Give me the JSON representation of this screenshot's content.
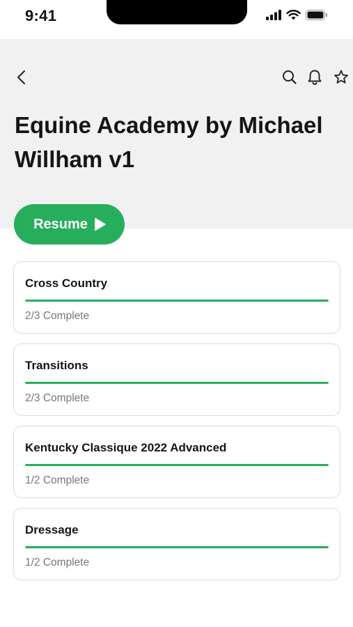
{
  "status_bar": {
    "time": "9:41",
    "icons": [
      "signal-icon",
      "wifi-icon",
      "battery-icon"
    ]
  },
  "toolbar": {
    "icons": [
      "back-arrow-icon",
      "search-icon",
      "bell-icon",
      "star-icon"
    ]
  },
  "page": {
    "title": "Equine Academy by Michael Willham v1"
  },
  "resume_button": {
    "label": "Resume",
    "icon": "play-icon"
  },
  "colors": {
    "accent": "#27ae5d",
    "header_bg": "#f1f1f1",
    "card_border": "#dcdcdc",
    "muted_text": "#777777"
  },
  "courses": [
    {
      "title": "Cross Country",
      "status": "2/3 Complete",
      "progress": 1.0
    },
    {
      "title": "Transitions",
      "status": "2/3 Complete",
      "progress": 1.0
    },
    {
      "title": "Kentucky Classique 2022 Advanced",
      "status": "1/2 Complete",
      "progress": 1.0
    },
    {
      "title": "Dressage",
      "status": "1/2 Complete",
      "progress": 1.0
    }
  ]
}
